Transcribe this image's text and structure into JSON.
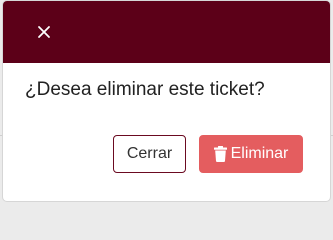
{
  "modal": {
    "message": "¿Desea eliminar este ticket?",
    "close_icon": "close-icon",
    "header_color": "#5c0018",
    "buttons": {
      "cancel_label": "Cerrar",
      "delete_label": "Eliminar",
      "delete_icon": "trash-icon",
      "delete_color": "#e45d5f"
    }
  }
}
